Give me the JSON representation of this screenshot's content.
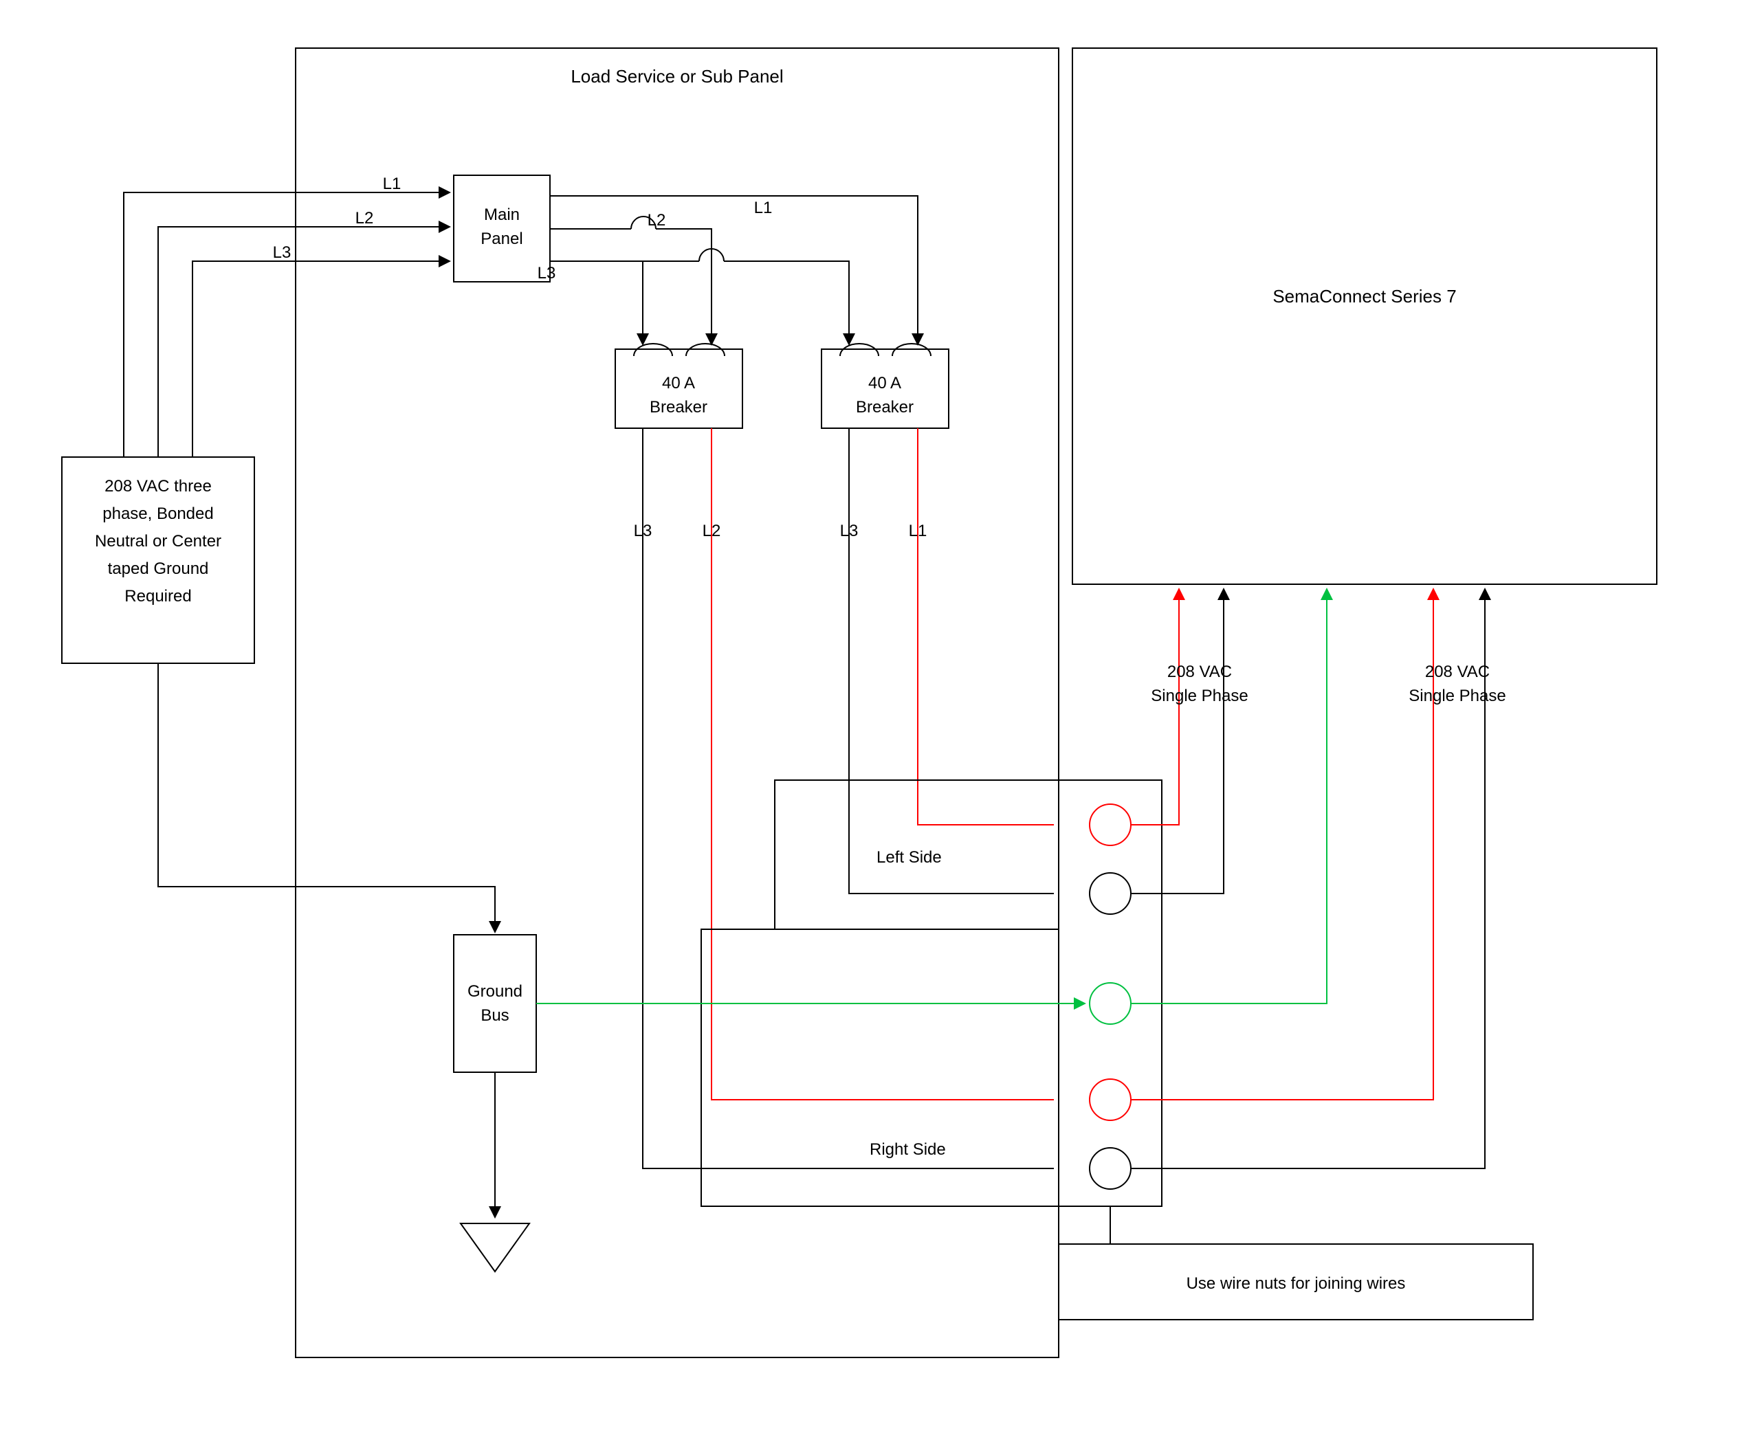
{
  "boxes": {
    "source": "208 VAC three phase, Bonded Neutral or Center taped Ground Required",
    "panel_container": "Load Service or Sub Panel",
    "main_panel_l1": "Main",
    "main_panel_l2": "Panel",
    "breaker1_l1": "40 A",
    "breaker1_l2": "Breaker",
    "breaker2_l1": "40 A",
    "breaker2_l2": "Breaker",
    "ground_bus_l1": "Ground",
    "ground_bus_l2": "Bus",
    "semaconnect": "SemaConnect Series 7",
    "wirenuts": "Use wire nuts for joining wires"
  },
  "wires": {
    "l1": "L1",
    "l2": "L2",
    "l3": "L3"
  },
  "labels": {
    "left_side": "Left Side",
    "right_side": "Right Side",
    "phase1": "208 VAC",
    "phase1b": "Single Phase",
    "phase2": "208 VAC",
    "phase2b": "Single Phase"
  }
}
